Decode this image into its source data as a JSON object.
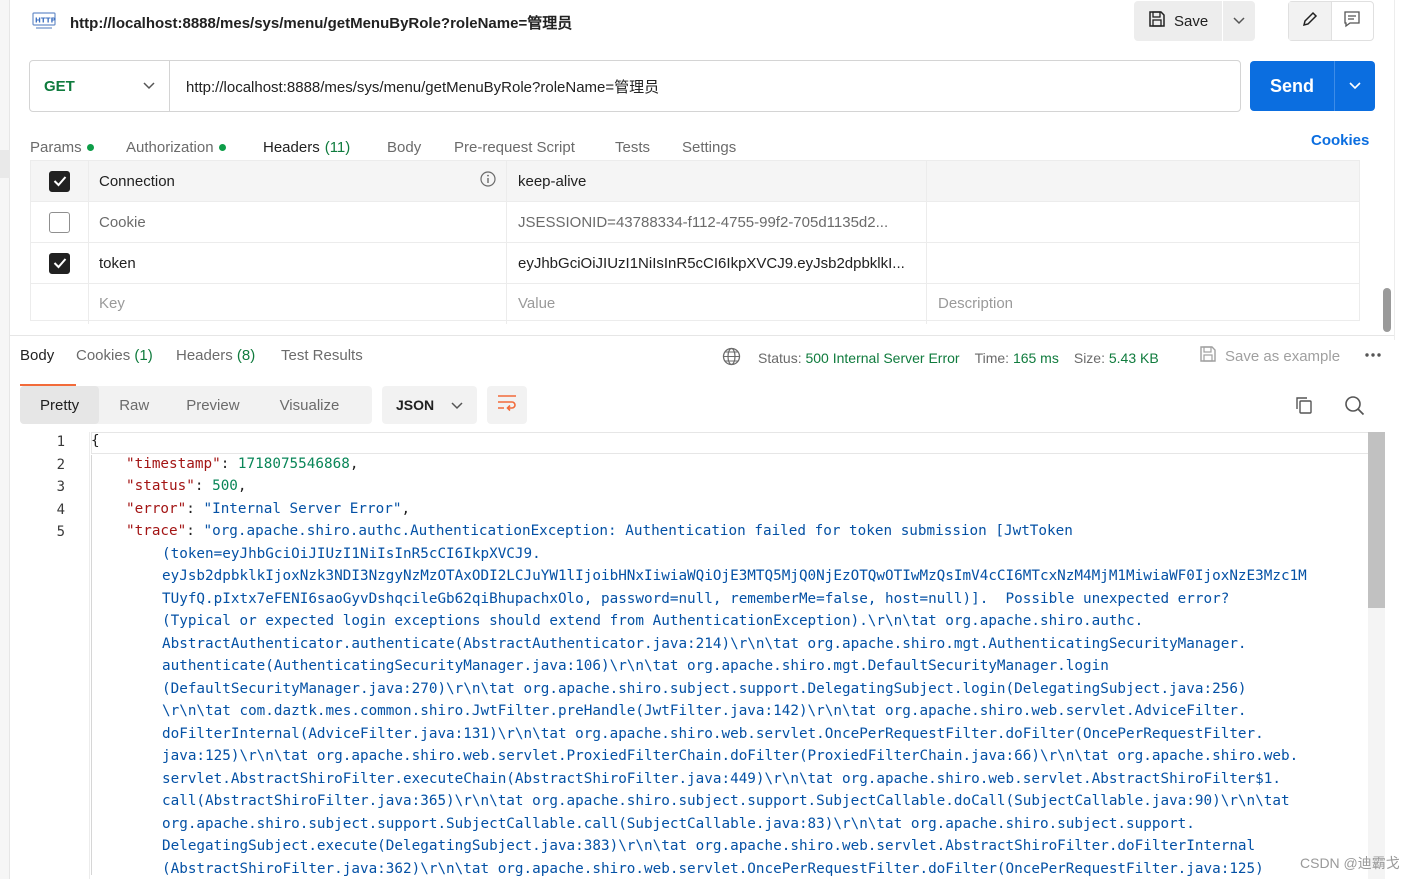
{
  "request": {
    "title": "http://localhost:8888/mes/sys/menu/getMenuByRole?roleName=管理员",
    "method": "GET",
    "url": "http://localhost:8888/mes/sys/menu/getMenuByRole?roleName=管理员",
    "save_label": "Save",
    "send_label": "Send"
  },
  "request_tabs": [
    {
      "label": "Params",
      "has_dot": true
    },
    {
      "label": "Authorization",
      "has_dot": true
    },
    {
      "label": "Headers",
      "count": "(11)",
      "active": true
    },
    {
      "label": "Body"
    },
    {
      "label": "Pre-request Script"
    },
    {
      "label": "Tests"
    },
    {
      "label": "Settings"
    }
  ],
  "cookies_link": "Cookies",
  "headers": [
    {
      "checked": true,
      "key": "Connection",
      "value": "keep-alive"
    },
    {
      "checked": false,
      "key": "Cookie",
      "value": "JSESSIONID=43788334-f112-4755-99f2-705d1135d2..."
    },
    {
      "checked": true,
      "key": "token",
      "value": "eyJhbGciOiJIUzI1NiIsInR5cCI6IkpXVCJ9.eyJsb2dpbklkI..."
    }
  ],
  "headers_placeholder": {
    "key": "Key",
    "value": "Value",
    "description": "Description"
  },
  "response_tabs": [
    {
      "label": "Body",
      "active": true
    },
    {
      "label": "Cookies",
      "count": "(1)"
    },
    {
      "label": "Headers",
      "count": "(8)"
    },
    {
      "label": "Test Results"
    }
  ],
  "response_status": {
    "status_label": "Status:",
    "status_value": "500 Internal Server Error",
    "time_label": "Time:",
    "time_value": "165 ms",
    "size_label": "Size:",
    "size_value": "5.43 KB",
    "save_example": "Save as example"
  },
  "view_modes": [
    "Pretty",
    "Raw",
    "Preview",
    "Visualize"
  ],
  "active_view": "Pretty",
  "format": "JSON",
  "code": {
    "line_numbers": [
      "1",
      "2",
      "3",
      "4",
      "5"
    ],
    "open_brace": "{",
    "timestamp_key": "\"timestamp\"",
    "timestamp_val": "1718075546868",
    "status_key": "\"status\"",
    "status_val": "500",
    "error_key": "\"error\"",
    "error_val": "\"Internal Server Error\"",
    "trace_key": "\"trace\"",
    "trace_lines": [
      "\"org.apache.shiro.authc.AuthenticationException: Authentication failed for token submission [JwtToken",
      "(token=eyJhbGciOiJIUzI1NiIsInR5cCI6IkpXVCJ9.",
      "eyJsb2dpbklkIjoxNzk3NDI3NzgyNzMzOTAxODI2LCJuYW1lIjoibHNxIiwiaWQiOjE3MTQ5MjQ0NjEzOTQwOTIwMzQsImV4cCI6MTcxNzM4MjM1MiwiaWF0IjoxNzE3Mzc1M",
      "TUyfQ.pIxtx7eFENI6saoGyvDshqcileGb62qiBhupachxOlo, password=null, rememberMe=false, host=null)].  Possible unexpected error?",
      "(Typical or expected login exceptions should extend from AuthenticationException).\\r\\n\\tat org.apache.shiro.authc.",
      "AbstractAuthenticator.authenticate(AbstractAuthenticator.java:214)\\r\\n\\tat org.apache.shiro.mgt.AuthenticatingSecurityManager.",
      "authenticate(AuthenticatingSecurityManager.java:106)\\r\\n\\tat org.apache.shiro.mgt.DefaultSecurityManager.login",
      "(DefaultSecurityManager.java:270)\\r\\n\\tat org.apache.shiro.subject.support.DelegatingSubject.login(DelegatingSubject.java:256)",
      "\\r\\n\\tat com.daztk.mes.common.shiro.JwtFilter.preHandle(JwtFilter.java:142)\\r\\n\\tat org.apache.shiro.web.servlet.AdviceFilter.",
      "doFilterInternal(AdviceFilter.java:131)\\r\\n\\tat org.apache.shiro.web.servlet.OncePerRequestFilter.doFilter(OncePerRequestFilter.",
      "java:125)\\r\\n\\tat org.apache.shiro.web.servlet.ProxiedFilterChain.doFilter(ProxiedFilterChain.java:66)\\r\\n\\tat org.apache.shiro.web.",
      "servlet.AbstractShiroFilter.executeChain(AbstractShiroFilter.java:449)\\r\\n\\tat org.apache.shiro.web.servlet.AbstractShiroFilter$1.",
      "call(AbstractShiroFilter.java:365)\\r\\n\\tat org.apache.shiro.subject.support.SubjectCallable.doCall(SubjectCallable.java:90)\\r\\n\\tat",
      "org.apache.shiro.subject.support.SubjectCallable.call(SubjectCallable.java:83)\\r\\n\\tat org.apache.shiro.subject.support.",
      "DelegatingSubject.execute(DelegatingSubject.java:383)\\r\\n\\tat org.apache.shiro.web.servlet.AbstractShiroFilter.doFilterInternal",
      "(AbstractShiroFilter.java:362)\\r\\n\\tat org.apache.shiro.web.servlet.OncePerRequestFilter.doFilter(OncePerRequestFilter.java:125)"
    ]
  },
  "watermark": "CSDN @迪霸戈",
  "colors": {
    "send_blue": "#0b6ee0",
    "method_green": "#0f7b3d",
    "accent_orange": "#f26b3a",
    "json_key": "#a31515",
    "json_string": "#0451a5",
    "json_number": "#098658"
  }
}
